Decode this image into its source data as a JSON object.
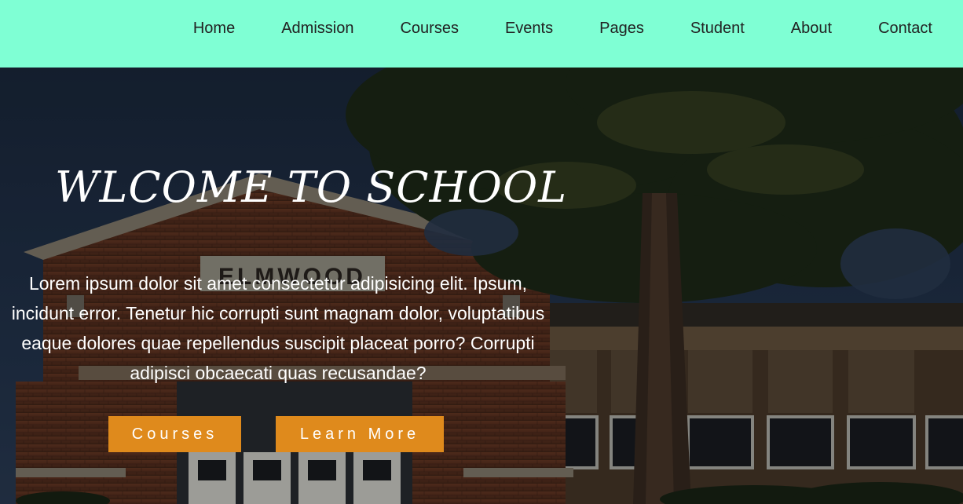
{
  "nav": {
    "items": [
      {
        "label": "Home"
      },
      {
        "label": "Admission"
      },
      {
        "label": "Courses"
      },
      {
        "label": "Events"
      },
      {
        "label": "Pages"
      },
      {
        "label": "Student"
      },
      {
        "label": "About"
      },
      {
        "label": "Contact"
      }
    ]
  },
  "hero": {
    "title": "WLCOME TO SCHOOL",
    "building_sign": "ELMWOOD",
    "text_lines": [
      "Lorem ipsum dolor sit amet consectetur adipisicing elit. Ipsum,",
      "incidunt error. Tenetur hic corrupti sunt magnam dolor, voluptatibus",
      "eaque dolores quae repellendus suscipit placeat porro? Corrupti",
      "adipisci obcaecati quas recusandae?"
    ],
    "buttons": {
      "courses": "Courses",
      "learn_more": "Learn More"
    }
  },
  "colors": {
    "nav_bg": "#7fffd4",
    "button_bg": "#df8a1c",
    "text_light": "#ffffff"
  }
}
